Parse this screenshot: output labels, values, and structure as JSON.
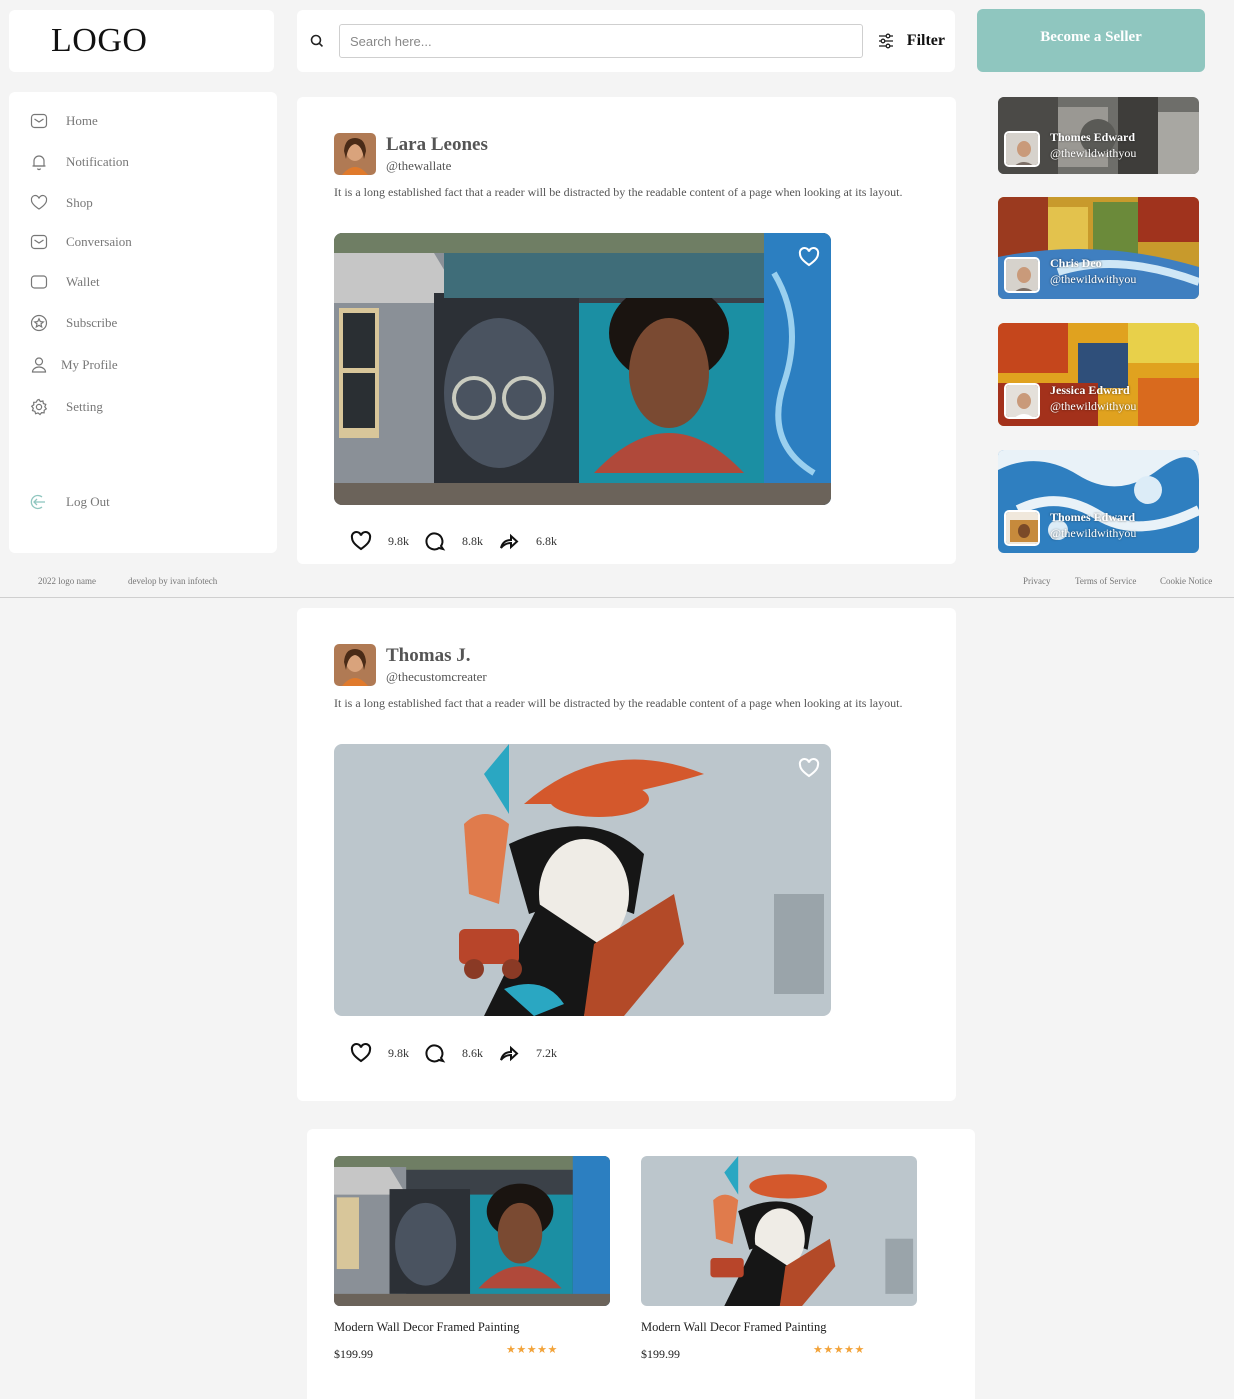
{
  "brand": {
    "logo": "LOGO"
  },
  "search": {
    "placeholder": "Search here...",
    "filter_label": "Filter"
  },
  "header": {
    "become_seller": "Become a Seller"
  },
  "sidebar": {
    "items": [
      {
        "label": "Home",
        "icon": "mail-icon"
      },
      {
        "label": "Notification",
        "icon": "bell-icon"
      },
      {
        "label": "Shop",
        "icon": "heart-icon"
      },
      {
        "label": "Conversaion",
        "icon": "message-icon"
      },
      {
        "label": "Wallet",
        "icon": "wallet-icon"
      },
      {
        "label": "Subscribe",
        "icon": "subscribe-icon"
      },
      {
        "label": "My Profile",
        "icon": "user-icon"
      },
      {
        "label": "Setting",
        "icon": "gear-icon"
      }
    ],
    "logout": {
      "label": "Log Out",
      "icon": "logout-icon"
    }
  },
  "footer": {
    "copyright": "2022 logo name",
    "credit": "develop by ivan infotech",
    "links": [
      "Privacy",
      "Terms of Service",
      "Cookie Notice"
    ]
  },
  "posts": [
    {
      "name": "Lara Leones",
      "handle": "@thewallate",
      "text": "It is a long established fact that a reader will be distracted by the readable content of a page when looking at its layout.",
      "likes": "9.8k",
      "comments": "8.8k",
      "shares": "6.8k"
    },
    {
      "name": "Thomas J.",
      "handle": "@thecustomcreater",
      "text": "It is a long established fact that a reader will be distracted by the readable content of a page when looking at its layout.",
      "likes": "9.8k",
      "comments": "8.6k",
      "shares": "7.2k"
    }
  ],
  "suggestions": [
    {
      "name": "Thomes Edward",
      "handle": "@thewildwithyou"
    },
    {
      "name": "Chris Deo",
      "handle": "@thewildwithyou"
    },
    {
      "name": "Jessica Edward",
      "handle": "@thewildwithyou"
    },
    {
      "name": "Thomes Edward",
      "handle": "@thewildwithyou"
    }
  ],
  "products": [
    {
      "title": "Modern Wall Decor Framed Painting",
      "price": "$199.99",
      "stars": "★★★★★",
      "rating": 5
    },
    {
      "title": "Modern Wall Decor Framed Painting",
      "price": "$199.99",
      "stars": "★★★★★",
      "rating": 5
    }
  ],
  "colors": {
    "accent": "#8fc6bf",
    "background": "#f4f4f4",
    "star": "#f2a33a"
  }
}
